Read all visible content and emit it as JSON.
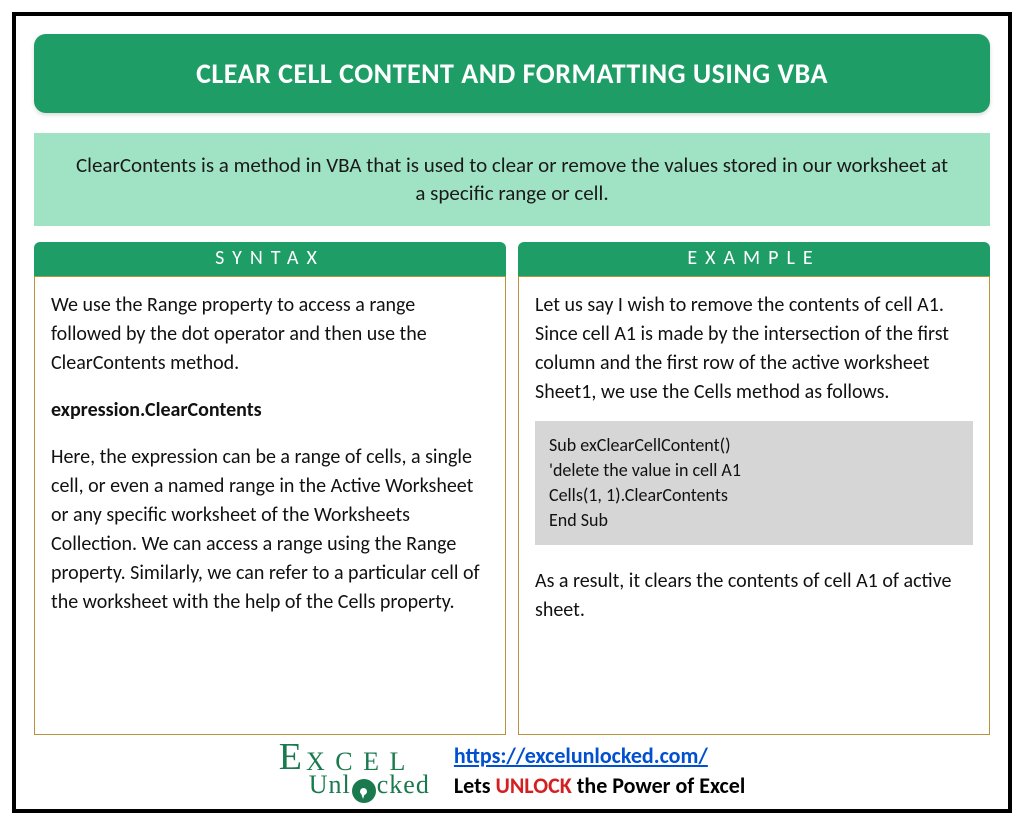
{
  "title": "CLEAR CELL CONTENT AND FORMATTING USING VBA",
  "intro": "ClearContents is a method in VBA that is used to clear or remove the values stored in our worksheet at a specific range or cell.",
  "columns": {
    "syntax": {
      "header": "SYNTAX",
      "para1": "We use the Range property to access a range followed by the dot operator and then use the ClearContents method.",
      "expression": "expression.ClearContents",
      "para2": "Here, the expression can be a range of cells, a single cell, or even a named range in the Active Worksheet or any specific worksheet of the Worksheets Collection. We can access a range using the Range property. Similarly, we can refer to a particular cell of the worksheet with the help of the Cells property."
    },
    "example": {
      "header": "EXAMPLE",
      "para1": "Let us say I wish to remove the contents of cell A1. Since cell A1 is made by the intersection of the first column and the first row of the active worksheet Sheet1, we use the Cells method as follows.",
      "code": "Sub exClearCellContent()\n'delete the value in cell A1\nCells(1, 1).ClearContents\nEnd Sub",
      "para2": "As a result, it clears the contents of cell A1 of active sheet."
    }
  },
  "footer": {
    "logo_top": "EXCEL",
    "logo_bottom_left": "Unl",
    "logo_bottom_right": "cked",
    "url": "https://excelunlocked.com/",
    "tagline_pre": "Lets ",
    "tagline_highlight": "UNLOCK",
    "tagline_post": " the Power of Excel"
  }
}
